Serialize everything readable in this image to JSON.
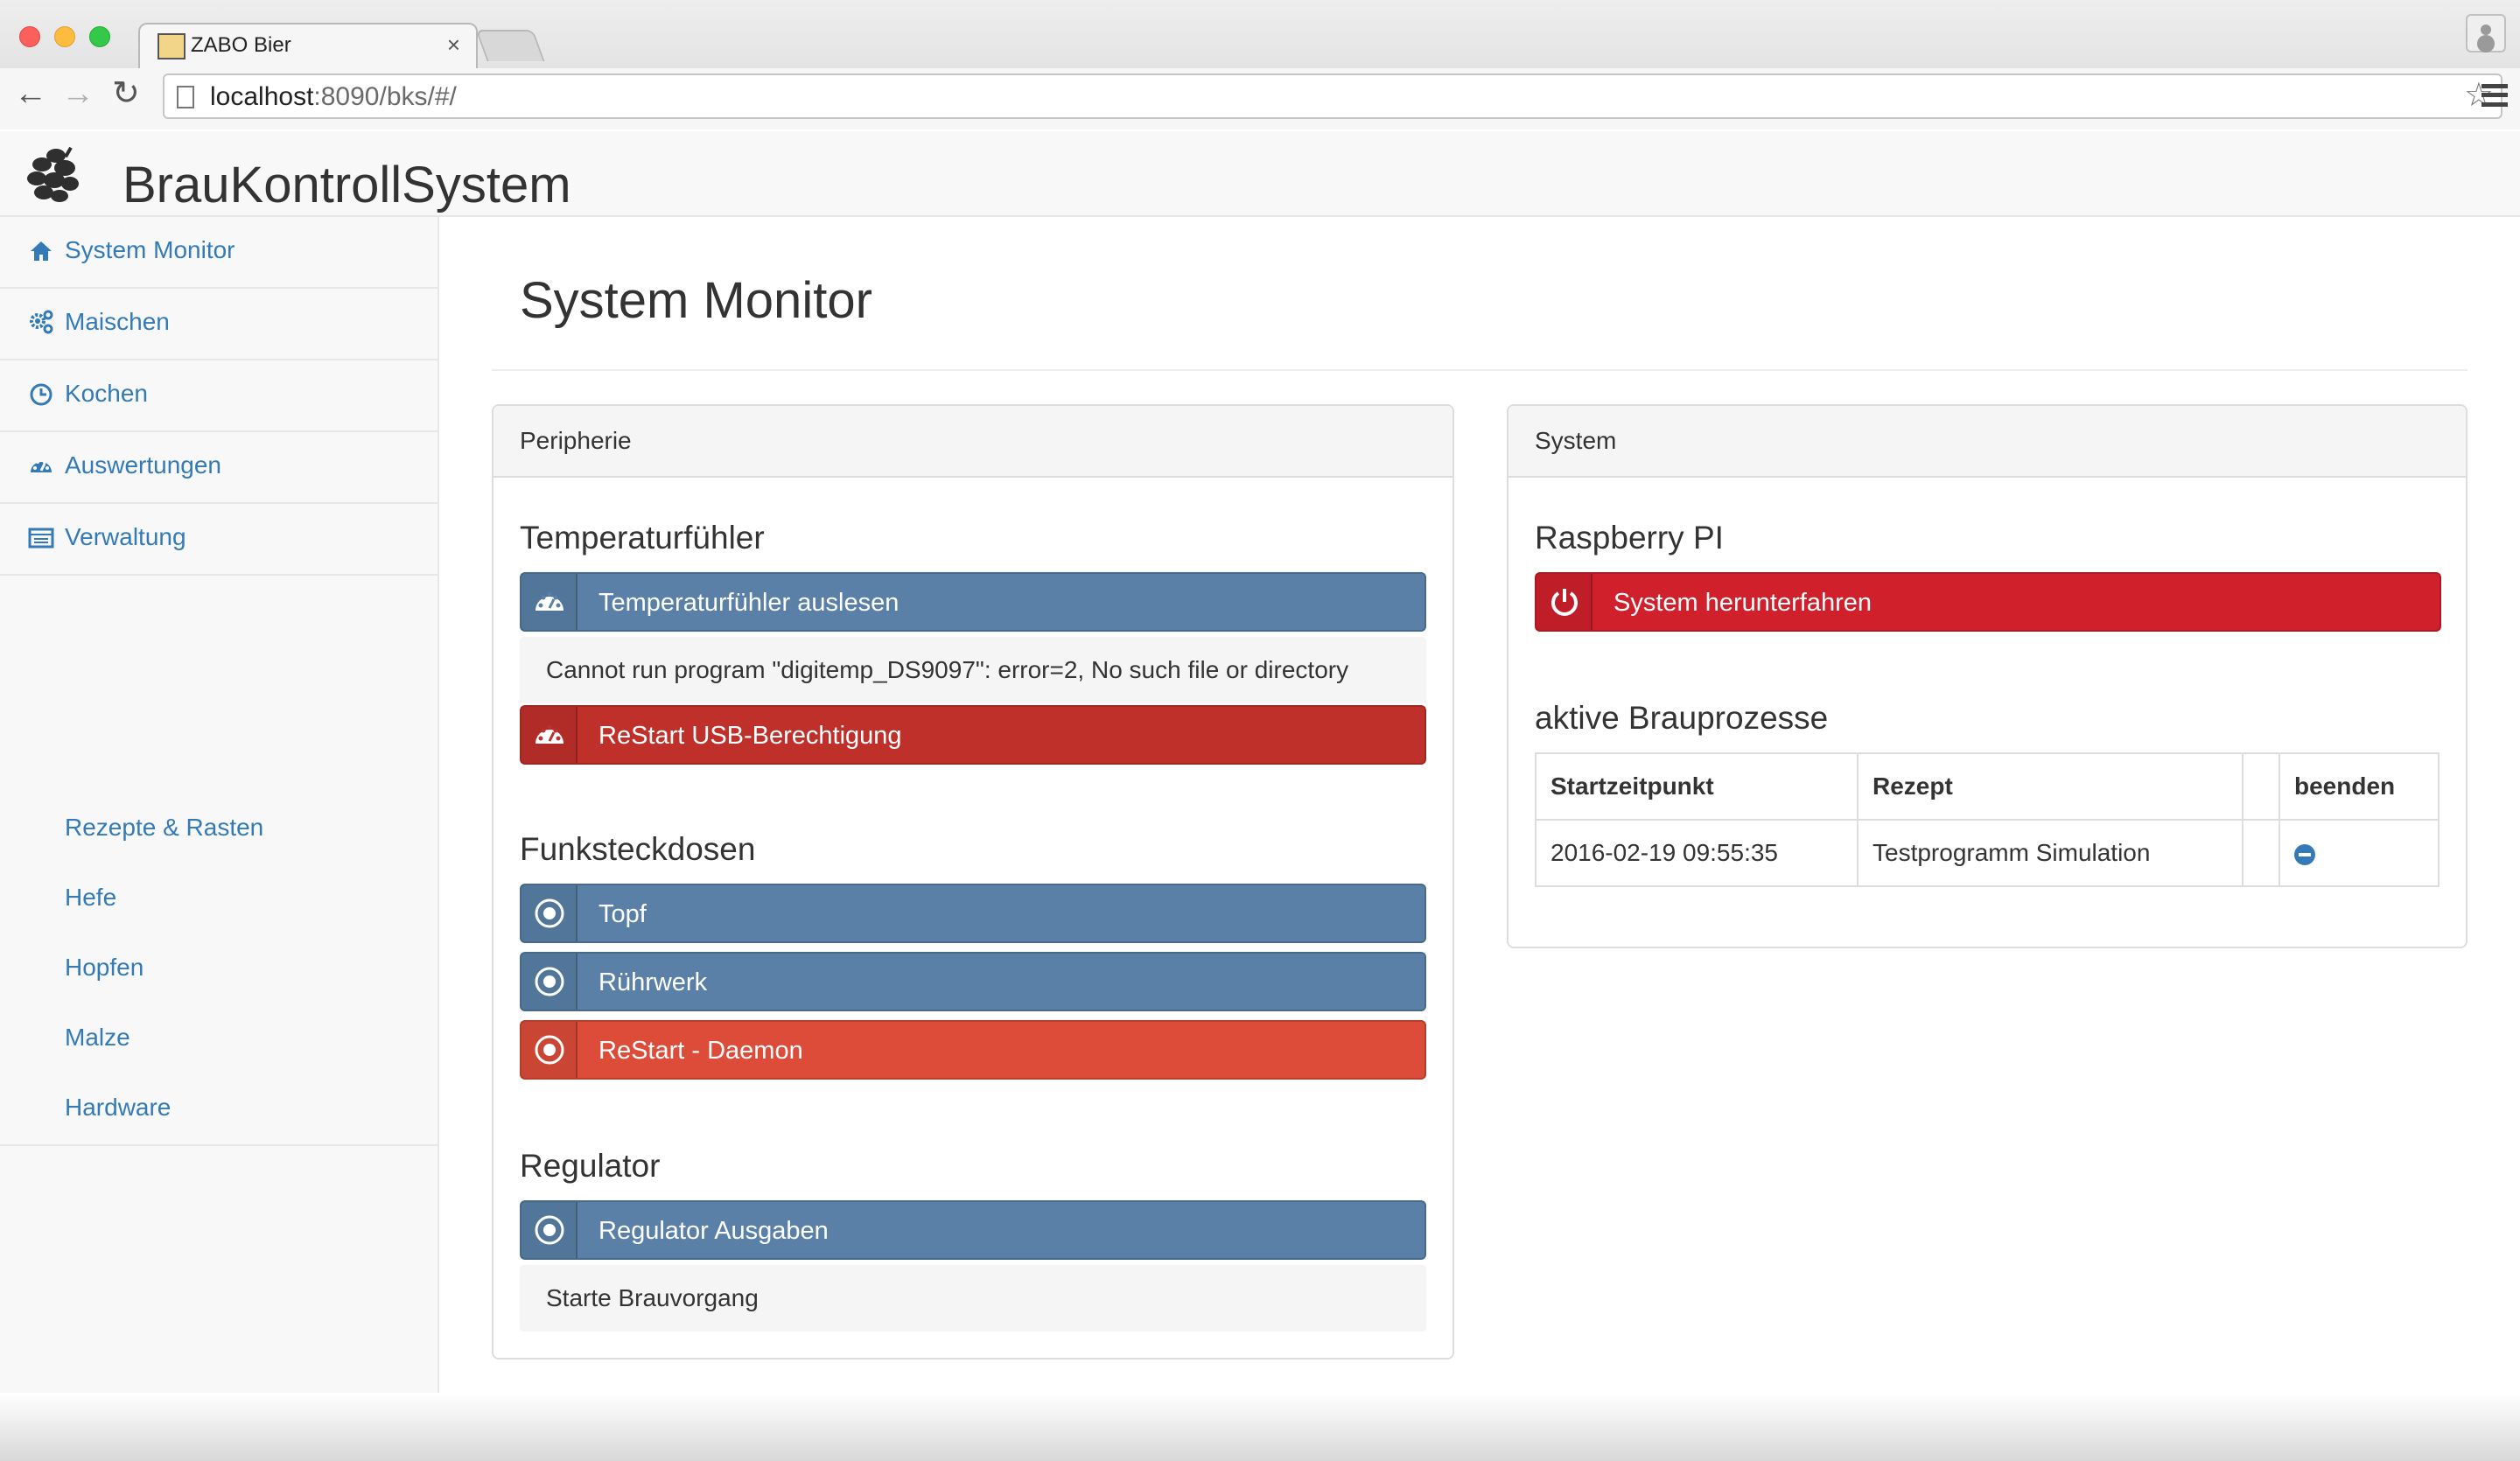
{
  "browser": {
    "tab_title": "ZABO Bier",
    "tab_close": "×",
    "url_host": "localhost",
    "url_path": ":8090/bks/#/"
  },
  "header": {
    "brand": "BrauKontrollSystem"
  },
  "sidebar": {
    "items": [
      {
        "label": "System Monitor",
        "icon": "home-icon"
      },
      {
        "label": "Maischen",
        "icon": "cogs-icon"
      },
      {
        "label": "Kochen",
        "icon": "clock-icon"
      },
      {
        "label": "Auswertungen",
        "icon": "dashboard-icon"
      },
      {
        "label": "Verwaltung",
        "icon": "list-icon"
      }
    ],
    "subitems": [
      {
        "label": "Rezepte & Rasten"
      },
      {
        "label": "Hefe"
      },
      {
        "label": "Hopfen"
      },
      {
        "label": "Malze"
      },
      {
        "label": "Hardware"
      }
    ]
  },
  "main": {
    "title": "System Monitor",
    "peripherie": {
      "heading": "Peripherie",
      "temp": {
        "title": "Temperaturfühler",
        "read_button": "Temperaturfühler auslesen",
        "message": "Cannot run program \"digitemp_DS9097\": error=2, No such file or directory",
        "restart_button": "ReStart USB-Berechtigung"
      },
      "sockets": {
        "title": "Funksteckdosen",
        "buttons": [
          {
            "label": "Topf"
          },
          {
            "label": "Rührwerk"
          },
          {
            "label": "ReStart - Daemon"
          }
        ]
      },
      "regulator": {
        "title": "Regulator",
        "button": "Regulator Ausgaben",
        "message": "Starte Brauvorgang"
      }
    },
    "system": {
      "heading": "System",
      "pi": {
        "title": "Raspberry PI",
        "shutdown_button": "System herunterfahren"
      },
      "processes": {
        "title": "aktive Brauprozesse",
        "columns": [
          "Startzeitpunkt",
          "Rezept",
          "",
          "beenden"
        ],
        "rows": [
          {
            "start": "2016-02-19 09:55:35",
            "recipe": "Testprogramm Simulation",
            "extra": ""
          }
        ]
      }
    }
  },
  "colors": {
    "link": "#337ab7",
    "btn_blue": "#5a80a8",
    "btn_darkred": "#c0302a",
    "btn_orange": "#dd4b39",
    "btn_red": "#d0202c"
  }
}
